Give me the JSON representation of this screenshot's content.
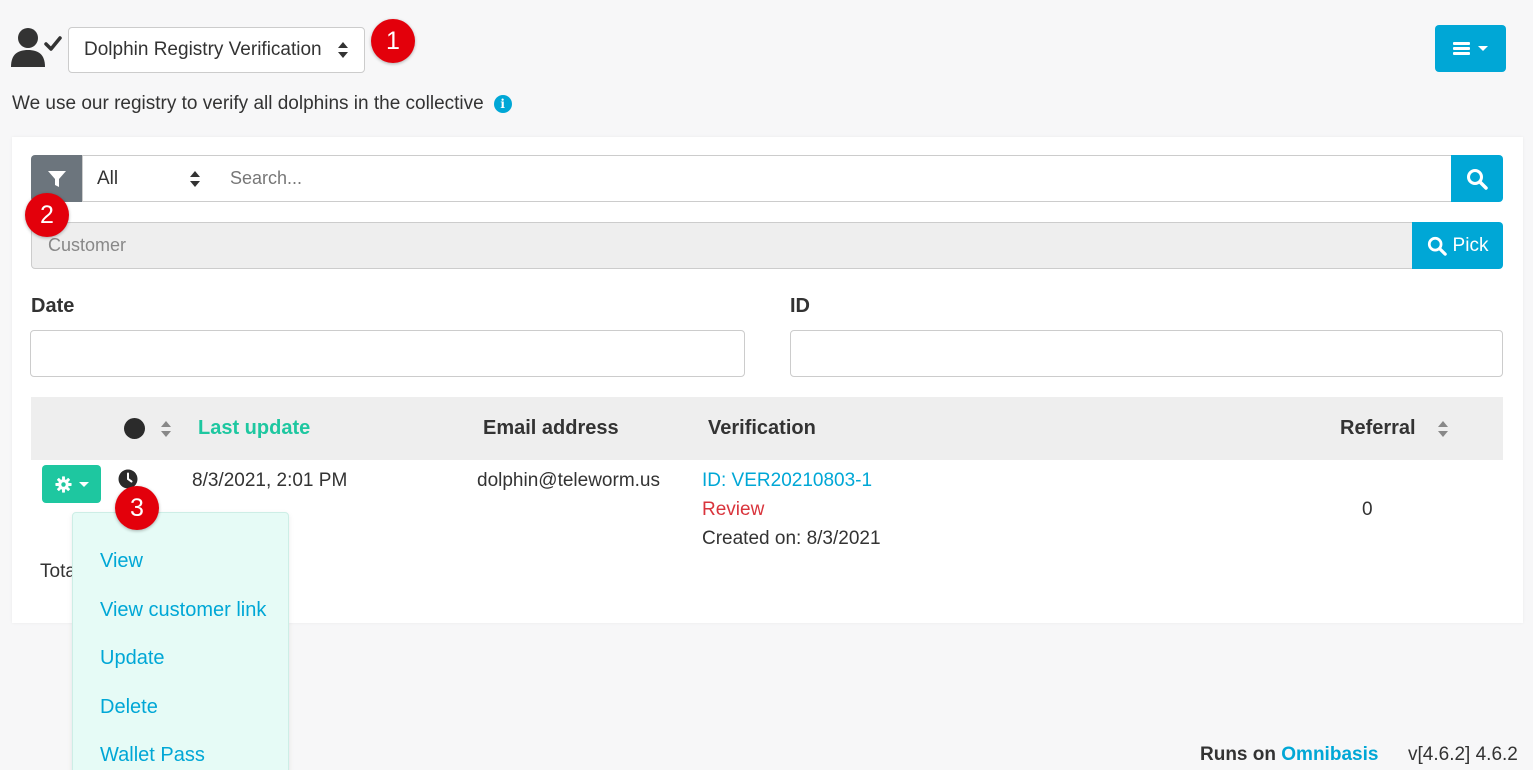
{
  "header": {
    "module_selected": "Dolphin Registry Verification",
    "description": "We use our registry to verify all dolphins in the collective"
  },
  "markers": [
    "1",
    "2",
    "3"
  ],
  "filters": {
    "type_selected": "All",
    "search_placeholder": "Search...",
    "customer_placeholder": "Customer",
    "pick_label": "Pick",
    "date_label": "Date",
    "id_label": "ID"
  },
  "table": {
    "columns": {
      "last_update": "Last update",
      "email": "Email address",
      "verification": "Verification",
      "referral": "Referral"
    },
    "rows": [
      {
        "last_update": "8/3/2021, 2:01 PM",
        "email": "dolphin@teleworm.us",
        "verification_id": "ID: VER20210803-1",
        "verification_status": "Review",
        "verification_created": "Created on: 8/3/2021",
        "referral": "0"
      }
    ],
    "total_label": "Tota"
  },
  "action_menu": {
    "items": [
      "View",
      "View customer link",
      "Update",
      "Delete",
      "Wallet Pass"
    ]
  },
  "footer": {
    "runs_on": "Runs on",
    "brand": "Omnibasis",
    "version": "v[4.6.2] 4.6.2"
  },
  "colors": {
    "primary": "#00a7d6",
    "success": "#1ec7a0",
    "danger_text": "#d9343c",
    "marker": "#e3000b",
    "dropdown_bg": "#e6fbf6"
  },
  "icons": [
    "user-check-icon",
    "info-icon",
    "hamburger-icon",
    "filter-icon",
    "search-icon",
    "gear-icon",
    "clock-icon",
    "sort-icon"
  ]
}
